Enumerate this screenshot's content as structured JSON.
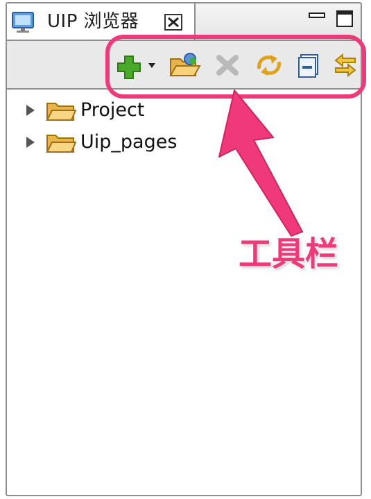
{
  "view": {
    "tab_title": "UIP 浏览器",
    "tab_icon": "monitor-icon",
    "close_icon": "close-icon",
    "minimize_icon": "minimize-icon",
    "maximize_icon": "maximize-icon"
  },
  "toolbar": {
    "buttons": [
      {
        "name": "new-button",
        "icon": "green-plus-icon",
        "has_dropdown": true
      },
      {
        "name": "open-folder-button",
        "icon": "open-folder-icon"
      },
      {
        "name": "delete-button",
        "icon": "delete-x-icon",
        "enabled": false
      },
      {
        "name": "refresh-button",
        "icon": "sync-arrows-icon"
      },
      {
        "name": "collapse-all-button",
        "icon": "collapse-all-icon"
      },
      {
        "name": "link-with-editor-button",
        "icon": "link-arrows-icon"
      }
    ]
  },
  "tree": {
    "items": [
      {
        "label": "Project",
        "icon": "folder-icon",
        "expanded": false
      },
      {
        "label": "Uip_pages",
        "icon": "folder-icon",
        "expanded": false
      }
    ]
  },
  "annotation": {
    "label": "工具栏",
    "color": "#f0397a"
  }
}
